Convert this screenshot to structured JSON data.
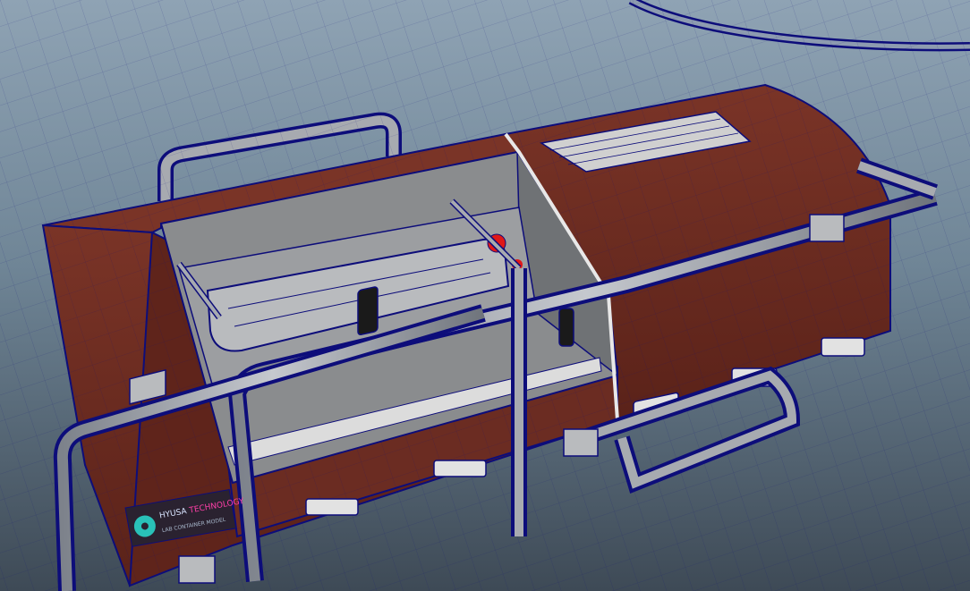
{
  "viewport": {
    "label": "",
    "background_top": "#8fa3b4",
    "background_bottom": "#3e4a56"
  },
  "colors": {
    "hull": "#6b2c22",
    "hull_dark": "#4e1d16",
    "wire": "#0d0d7a",
    "interior": "#8a8c8e",
    "pipe": "#a7aab0",
    "accent_red": "#e01818",
    "light_panel": "#dcdcdc",
    "logo_teal": "#29c1b8",
    "logo_magenta": "#ff3fa8"
  },
  "decal": {
    "brand_primary": "HYUSA",
    "brand_secondary": "TECHNOLOGY",
    "subline": "LAB CONTAINER MODEL",
    "icon": "aperture-icon"
  }
}
